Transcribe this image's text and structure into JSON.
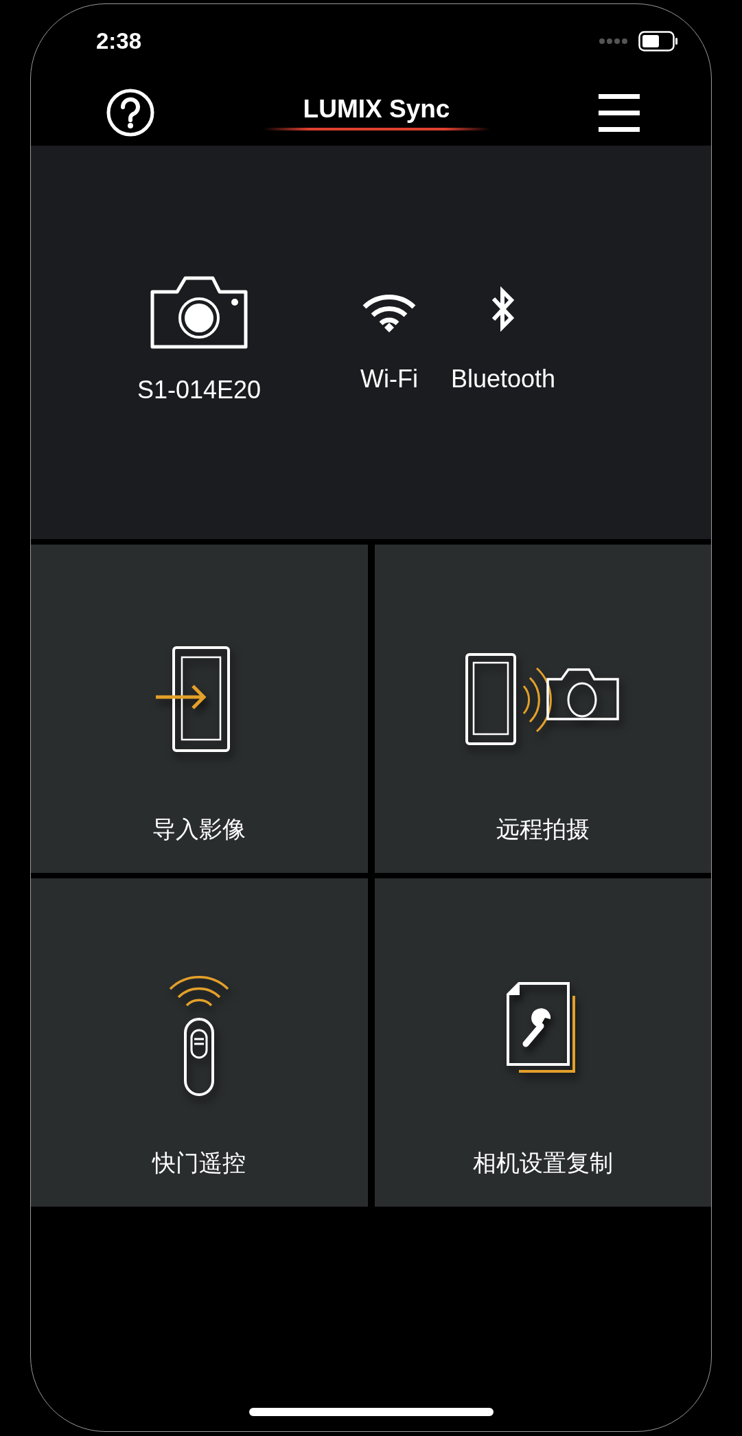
{
  "status_bar": {
    "time": "2:38"
  },
  "header": {
    "title": "LUMIX Sync"
  },
  "device": {
    "name": "S1-014E20"
  },
  "connections": [
    {
      "kind": "wifi",
      "label": "Wi-Fi"
    },
    {
      "kind": "bluetooth",
      "label": "Bluetooth"
    }
  ],
  "tiles": [
    {
      "kind": "import",
      "label": "导入影像"
    },
    {
      "kind": "remote",
      "label": "远程拍摄"
    },
    {
      "kind": "shutter",
      "label": "快门遥控"
    },
    {
      "kind": "copy",
      "label": "相机设置复制"
    }
  ]
}
